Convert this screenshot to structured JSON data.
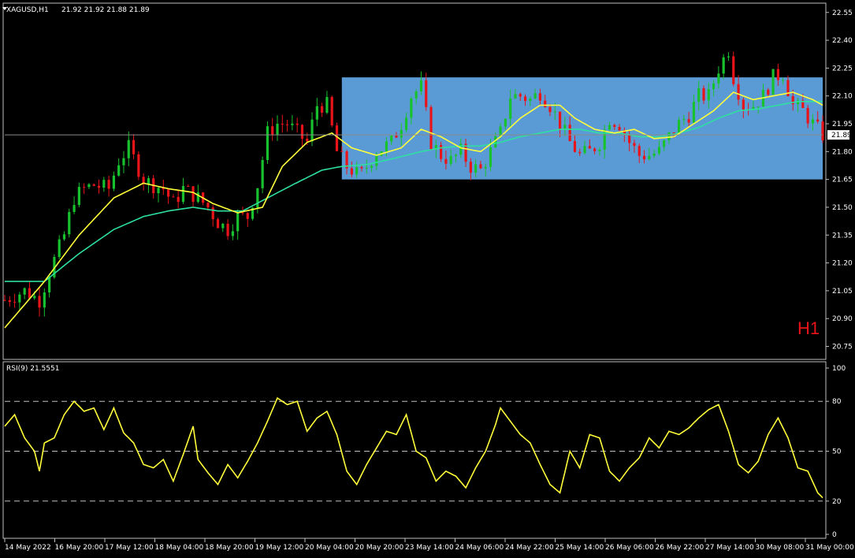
{
  "header": {
    "symbol": "XAGUSD,H1",
    "ohlc": "21.92 21.92 21.88 21.89"
  },
  "timeframe_label": "H1",
  "rsi_header": "RSI(9) 21.5551",
  "colors": {
    "background": "#000000",
    "bull": "#18c22e",
    "bear": "#e8141a",
    "ma_fast": "#ffff3a",
    "ma_slow": "#2ee0a0",
    "rsi": "#ffff3a",
    "zone": "#5b9bd5",
    "grid": "#c0c0c0"
  },
  "chart_data": [
    {
      "type": "candlestick",
      "symbol": "XAGUSD",
      "timeframe": "H1",
      "ylim": [
        20.68,
        22.6
      ],
      "y_ticks": [
        "22.55",
        "22.40",
        "22.25",
        "22.10",
        "21.95",
        "21.80",
        "21.65",
        "21.50",
        "21.35",
        "21.20",
        "21.05",
        "20.90",
        "20.75"
      ],
      "current_price": "21.89",
      "x_labels": [
        "14 May 2022",
        "16 May 20:00",
        "17 May 12:00",
        "18 May 04:00",
        "18 May 20:00",
        "19 May 12:00",
        "20 May 04:00",
        "20 May 20:00",
        "23 May 14:00",
        "24 May 06:00",
        "24 May 22:00",
        "25 May 14:00",
        "26 May 06:00",
        "26 May 22:00",
        "27 May 14:00",
        "30 May 08:00",
        "31 May 00:00"
      ],
      "close_path": [
        [
          0,
          21.0
        ],
        [
          4,
          21.05
        ],
        [
          7,
          21.0
        ],
        [
          9,
          21.15
        ],
        [
          12,
          21.35
        ],
        [
          14,
          21.55
        ],
        [
          16,
          21.6
        ],
        [
          18,
          21.62
        ],
        [
          21,
          21.6
        ],
        [
          23,
          21.75
        ],
        [
          25,
          21.82
        ],
        [
          28,
          21.65
        ],
        [
          30,
          21.62
        ],
        [
          32,
          21.6
        ],
        [
          34,
          21.52
        ],
        [
          36,
          21.6
        ],
        [
          39,
          21.55
        ],
        [
          41,
          21.5
        ],
        [
          43,
          21.42
        ],
        [
          45,
          21.38
        ],
        [
          47,
          21.45
        ],
        [
          49,
          21.45
        ],
        [
          51,
          21.62
        ],
        [
          53,
          21.9
        ],
        [
          55,
          21.95
        ],
        [
          57,
          21.95
        ],
        [
          59,
          21.9
        ],
        [
          61,
          21.85
        ],
        [
          63,
          22.05
        ],
        [
          65,
          22.05
        ],
        [
          67,
          21.8
        ],
        [
          69,
          21.72
        ],
        [
          71,
          21.68
        ],
        [
          72,
          21.68
        ],
        [
          75,
          21.8
        ],
        [
          78,
          21.85
        ],
        [
          80,
          21.95
        ],
        [
          82,
          22.1
        ],
        [
          84,
          22.15
        ],
        [
          86,
          21.85
        ],
        [
          88,
          21.78
        ],
        [
          90,
          21.75
        ],
        [
          92,
          21.8
        ],
        [
          94,
          21.72
        ],
        [
          96,
          21.7
        ],
        [
          98,
          21.8
        ],
        [
          100,
          21.9
        ],
        [
          102,
          22.1
        ],
        [
          104,
          22.1
        ],
        [
          106,
          22.08
        ],
        [
          108,
          22.12
        ],
        [
          110,
          22.05
        ],
        [
          112,
          21.95
        ],
        [
          114,
          21.85
        ],
        [
          116,
          21.78
        ],
        [
          118,
          21.8
        ],
        [
          120,
          21.85
        ],
        [
          122,
          21.98
        ],
        [
          124,
          21.95
        ],
        [
          126,
          21.85
        ],
        [
          128,
          21.78
        ],
        [
          130,
          21.78
        ],
        [
          132,
          21.8
        ],
        [
          134,
          21.88
        ],
        [
          136,
          21.95
        ],
        [
          138,
          22.0
        ],
        [
          140,
          22.1
        ],
        [
          142,
          22.1
        ],
        [
          144,
          22.25
        ],
        [
          146,
          22.35
        ],
        [
          147,
          22.2
        ],
        [
          149,
          22.05
        ],
        [
          151,
          22.05
        ],
        [
          153,
          22.1
        ],
        [
          155,
          22.2
        ],
        [
          157,
          22.22
        ],
        [
          159,
          22.05
        ],
        [
          161,
          22.02
        ],
        [
          163,
          21.95
        ],
        [
          165,
          21.89
        ]
      ],
      "ma_fast": [
        [
          0,
          20.85
        ],
        [
          8,
          21.1
        ],
        [
          15,
          21.35
        ],
        [
          22,
          21.55
        ],
        [
          28,
          21.63
        ],
        [
          33,
          21.6
        ],
        [
          38,
          21.58
        ],
        [
          42,
          21.52
        ],
        [
          47,
          21.47
        ],
        [
          52,
          21.5
        ],
        [
          56,
          21.72
        ],
        [
          61,
          21.85
        ],
        [
          66,
          21.9
        ],
        [
          70,
          21.82
        ],
        [
          75,
          21.78
        ],
        [
          80,
          21.82
        ],
        [
          84,
          21.92
        ],
        [
          88,
          21.88
        ],
        [
          92,
          21.82
        ],
        [
          96,
          21.8
        ],
        [
          100,
          21.88
        ],
        [
          104,
          21.98
        ],
        [
          108,
          22.05
        ],
        [
          112,
          22.05
        ],
        [
          115,
          21.98
        ],
        [
          119,
          21.92
        ],
        [
          123,
          21.9
        ],
        [
          127,
          21.92
        ],
        [
          131,
          21.87
        ],
        [
          135,
          21.88
        ],
        [
          139,
          21.95
        ],
        [
          143,
          22.02
        ],
        [
          147,
          22.12
        ],
        [
          151,
          22.08
        ],
        [
          155,
          22.1
        ],
        [
          159,
          22.12
        ],
        [
          163,
          22.08
        ],
        [
          165,
          22.05
        ]
      ],
      "ma_slow": [
        [
          0,
          21.1
        ],
        [
          8,
          21.1
        ],
        [
          15,
          21.25
        ],
        [
          22,
          21.38
        ],
        [
          28,
          21.45
        ],
        [
          33,
          21.48
        ],
        [
          38,
          21.5
        ],
        [
          43,
          21.48
        ],
        [
          48,
          21.48
        ],
        [
          53,
          21.55
        ],
        [
          58,
          21.62
        ],
        [
          64,
          21.7
        ],
        [
          68,
          21.72
        ],
        [
          73,
          21.73
        ],
        [
          78,
          21.76
        ],
        [
          84,
          21.8
        ],
        [
          88,
          21.82
        ],
        [
          92,
          21.83
        ],
        [
          96,
          21.83
        ],
        [
          100,
          21.85
        ],
        [
          104,
          21.88
        ],
        [
          108,
          21.9
        ],
        [
          112,
          21.92
        ],
        [
          116,
          21.92
        ],
        [
          120,
          21.9
        ],
        [
          124,
          21.9
        ],
        [
          128,
          21.88
        ],
        [
          132,
          21.88
        ],
        [
          136,
          21.9
        ],
        [
          140,
          21.93
        ],
        [
          144,
          21.98
        ],
        [
          148,
          22.02
        ],
        [
          152,
          22.03
        ],
        [
          156,
          22.05
        ],
        [
          160,
          22.07
        ],
        [
          163,
          22.07
        ],
        [
          165,
          22.07
        ]
      ],
      "range_box": {
        "x_start": 68,
        "x_end": 165,
        "y_low": 21.65,
        "y_high": 22.2
      }
    },
    {
      "type": "line",
      "name": "RSI(9)",
      "ylim": [
        0,
        100
      ],
      "y_ticks": [
        "100",
        "80",
        "50",
        "20",
        "0"
      ],
      "levels": [
        80,
        50,
        20
      ],
      "values": [
        [
          0,
          65
        ],
        [
          2,
          72
        ],
        [
          4,
          58
        ],
        [
          6,
          50
        ],
        [
          7,
          38
        ],
        [
          8,
          55
        ],
        [
          10,
          58
        ],
        [
          12,
          72
        ],
        [
          14,
          80
        ],
        [
          16,
          74
        ],
        [
          18,
          76
        ],
        [
          20,
          63
        ],
        [
          22,
          76
        ],
        [
          24,
          61
        ],
        [
          26,
          55
        ],
        [
          28,
          42
        ],
        [
          30,
          40
        ],
        [
          32,
          45
        ],
        [
          34,
          32
        ],
        [
          36,
          48
        ],
        [
          38,
          65
        ],
        [
          39,
          45
        ],
        [
          41,
          37
        ],
        [
          43,
          30
        ],
        [
          45,
          42
        ],
        [
          47,
          34
        ],
        [
          49,
          44
        ],
        [
          51,
          55
        ],
        [
          53,
          68
        ],
        [
          55,
          82
        ],
        [
          57,
          78
        ],
        [
          59,
          80
        ],
        [
          61,
          62
        ],
        [
          63,
          70
        ],
        [
          65,
          74
        ],
        [
          67,
          60
        ],
        [
          69,
          38
        ],
        [
          71,
          30
        ],
        [
          73,
          42
        ],
        [
          75,
          52
        ],
        [
          77,
          62
        ],
        [
          79,
          60
        ],
        [
          81,
          72
        ],
        [
          83,
          50
        ],
        [
          85,
          46
        ],
        [
          87,
          32
        ],
        [
          89,
          38
        ],
        [
          91,
          35
        ],
        [
          93,
          28
        ],
        [
          95,
          40
        ],
        [
          97,
          50
        ],
        [
          99,
          66
        ],
        [
          100,
          76
        ],
        [
          102,
          68
        ],
        [
          104,
          60
        ],
        [
          106,
          55
        ],
        [
          108,
          42
        ],
        [
          110,
          30
        ],
        [
          112,
          25
        ],
        [
          114,
          50
        ],
        [
          116,
          40
        ],
        [
          118,
          60
        ],
        [
          120,
          58
        ],
        [
          122,
          38
        ],
        [
          124,
          32
        ],
        [
          126,
          40
        ],
        [
          128,
          46
        ],
        [
          130,
          58
        ],
        [
          132,
          52
        ],
        [
          134,
          62
        ],
        [
          136,
          60
        ],
        [
          138,
          64
        ],
        [
          140,
          70
        ],
        [
          142,
          75
        ],
        [
          144,
          78
        ],
        [
          146,
          62
        ],
        [
          148,
          42
        ],
        [
          150,
          37
        ],
        [
          152,
          44
        ],
        [
          154,
          60
        ],
        [
          156,
          70
        ],
        [
          158,
          58
        ],
        [
          160,
          40
        ],
        [
          162,
          38
        ],
        [
          164,
          25
        ],
        [
          165,
          22
        ]
      ]
    }
  ]
}
